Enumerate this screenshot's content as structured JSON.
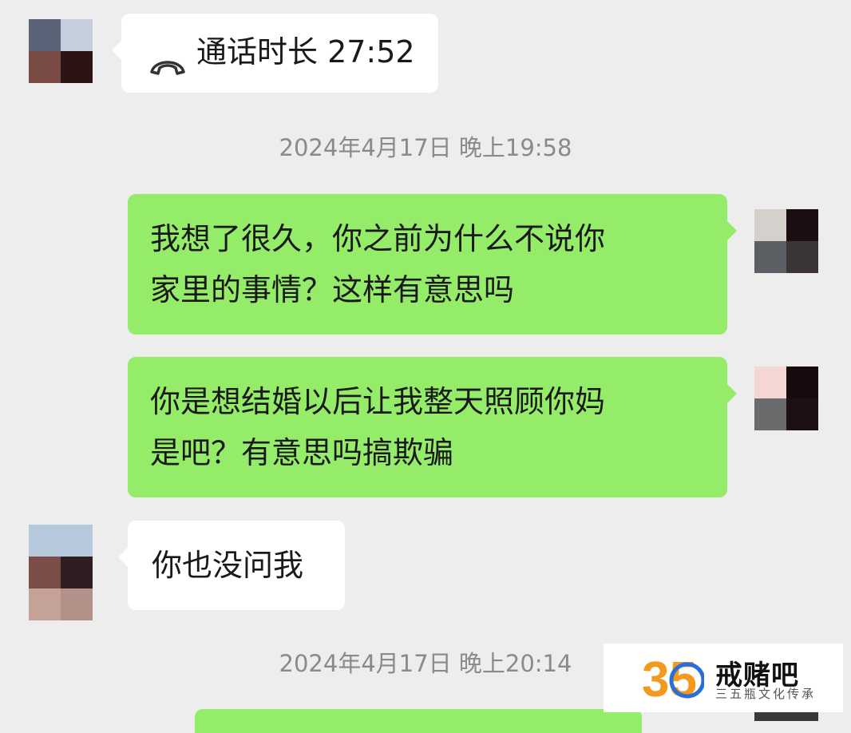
{
  "messages": [
    {
      "side": "left",
      "type": "call",
      "icon": "phone-hangup-icon",
      "text": "通话时长 27:52"
    },
    {
      "type": "timestamp",
      "text": "2024年4月17日 晚上19:58"
    },
    {
      "side": "right",
      "type": "text",
      "lines": [
        "我想了很久，你之前为什么不说你",
        "家里的事情？这样有意思吗"
      ]
    },
    {
      "side": "right",
      "type": "text",
      "lines": [
        "你是想结婚以后让我整天照顾你妈",
        "是吧？有意思吗搞欺骗"
      ]
    },
    {
      "side": "left",
      "type": "text",
      "lines": [
        "你也没问我"
      ]
    },
    {
      "type": "timestamp",
      "text": "2024年4月17日 晚上20:14"
    }
  ],
  "watermark": {
    "logo_text": "35",
    "name": "戒赌吧",
    "slogan": "三五瓶文化传承"
  },
  "colors": {
    "background": "#ededed",
    "bubble_sent": "#95ec69",
    "bubble_received": "#ffffff",
    "timestamp": "#8a8a8a",
    "logo_orange": "#f39a1e",
    "logo_blue": "#2a6fd6"
  }
}
